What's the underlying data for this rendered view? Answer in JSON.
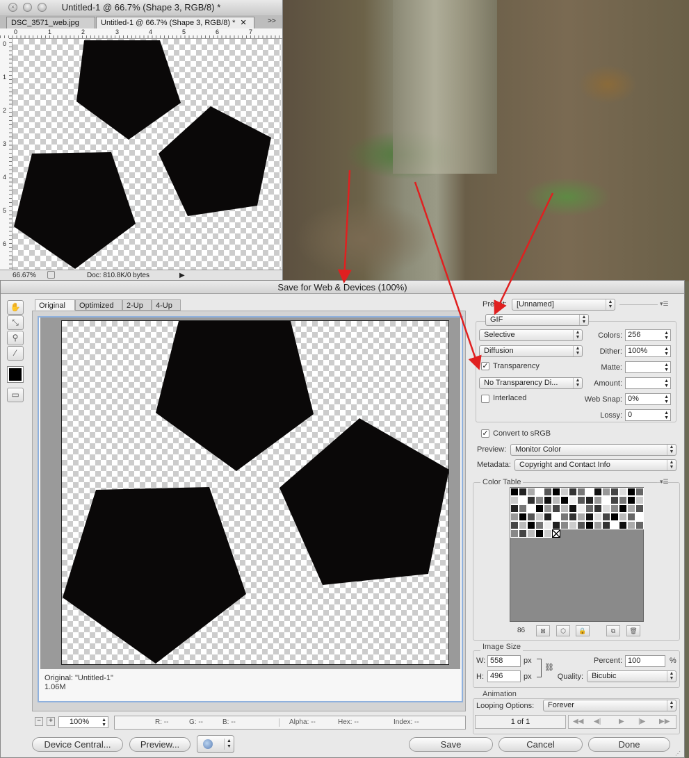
{
  "doc_window": {
    "title": "Untitled-1 @ 66.7% (Shape 3, RGB/8) *",
    "tabs": [
      {
        "label": "DSC_3571_web.jpg"
      },
      {
        "label": "Untitled-1 @ 66.7% (Shape 3, RGB/8) *",
        "close": "✕"
      }
    ],
    "tabs_overflow": ">>",
    "ruler_top": [
      "0",
      "1",
      "2",
      "3",
      "4",
      "5",
      "6",
      "7"
    ],
    "ruler_left": [
      "0",
      "1",
      "2",
      "3",
      "4",
      "5",
      "6"
    ],
    "zoom": "66.67%",
    "doc_size": "Doc: 810.8K/0 bytes"
  },
  "dialog": {
    "title": "Save for Web & Devices (100%)",
    "view_tabs": [
      "Original",
      "Optimized",
      "2-Up",
      "4-Up"
    ],
    "active_tab": "Original",
    "preview_info_line1": "Original: \"Untitled-1\"",
    "preview_info_line2": "1.06M",
    "image_width": 558,
    "image_height": 496
  },
  "settings": {
    "preset_label": "Preset:",
    "preset_value": "[Unnamed]",
    "format": "GIF",
    "reduction": "Selective",
    "dither_algorithm": "Diffusion",
    "transparency_label": "Transparency",
    "transparency_checked": true,
    "transparency_dither": "No Transparency Di...",
    "interlaced_label": "Interlaced",
    "interlaced_checked": false,
    "colors_label": "Colors:",
    "colors_value": "256",
    "dither_label": "Dither:",
    "dither_value": "100%",
    "matte_label": "Matte:",
    "matte_value": "",
    "amount_label": "Amount:",
    "amount_value": "",
    "websnap_label": "Web Snap:",
    "websnap_value": "0%",
    "lossy_label": "Lossy:",
    "lossy_value": "0",
    "convert_srgb_label": "Convert to sRGB",
    "convert_srgb_checked": true,
    "preview_label": "Preview:",
    "preview_value": "Monitor Color",
    "metadata_label": "Metadata:",
    "metadata_value": "Copyright and Contact Info"
  },
  "color_table": {
    "title": "Color Table",
    "count": "86",
    "swatches": [
      "#000",
      "#222",
      "#aaa",
      "#fff",
      "#555",
      "#000",
      "#ccc",
      "#333",
      "#777",
      "#fff",
      "#111",
      "#999",
      "#444",
      "#ddd",
      "#000",
      "#666",
      "#ccc",
      "#fff",
      "#333",
      "#888",
      "#111",
      "#bbb",
      "#000",
      "#eee",
      "#555",
      "#222",
      "#999",
      "#fff",
      "#444",
      "#777",
      "#000",
      "#ccc",
      "#222",
      "#777",
      "#fff",
      "#000",
      "#999",
      "#444",
      "#bbb",
      "#111",
      "#eee",
      "#666",
      "#333",
      "#ddd",
      "#888",
      "#000",
      "#aaa",
      "#555",
      "#999",
      "#000",
      "#555",
      "#ccc",
      "#222",
      "#fff",
      "#777",
      "#333",
      "#aaa",
      "#111",
      "#ddd",
      "#444",
      "#000",
      "#bbb",
      "#666",
      "#fff",
      "#444",
      "#bbb",
      "#000",
      "#777",
      "#eee",
      "#222",
      "#888",
      "#ccc",
      "#555",
      "#000",
      "#999",
      "#333",
      "#fff",
      "#111",
      "#aaa",
      "#666",
      "#888",
      "#444",
      "#bbb",
      "#000",
      "#ccc",
      "#transparent"
    ]
  },
  "image_size": {
    "title": "Image Size",
    "w_label": "W:",
    "w_value": "558",
    "h_label": "H:",
    "h_value": "496",
    "unit": "px",
    "percent_label": "Percent:",
    "percent_value": "100",
    "percent_unit": "%",
    "quality_label": "Quality:",
    "quality_value": "Bicubic"
  },
  "animation": {
    "title": "Animation",
    "looping_label": "Looping Options:",
    "looping_value": "Forever",
    "frame_counter": "1 of 1"
  },
  "status_bar": {
    "zoom": "100%",
    "r": "R: --",
    "g": "G: --",
    "b": "B: --",
    "alpha": "Alpha: --",
    "hex": "Hex: --",
    "index": "Index: --"
  },
  "buttons": {
    "device_central": "Device Central...",
    "preview": "Preview...",
    "save": "Save",
    "cancel": "Cancel",
    "done": "Done"
  }
}
